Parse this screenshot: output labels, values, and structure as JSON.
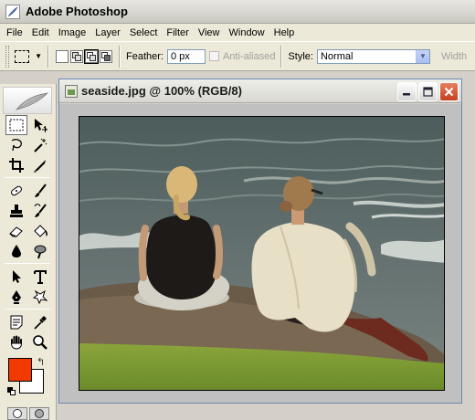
{
  "app": {
    "title": "Adobe Photoshop",
    "icon": "photoshop-feather-icon"
  },
  "menu": [
    "File",
    "Edit",
    "Image",
    "Layer",
    "Select",
    "Filter",
    "View",
    "Window",
    "Help"
  ],
  "options": {
    "feather_label": "Feather:",
    "feather_value": "0 px",
    "antialias_label": "Anti-aliased",
    "style_label": "Style:",
    "style_value": "Normal",
    "width_label": "Width"
  },
  "document": {
    "title": "seaside.jpg @ 100% (RGB/8)"
  },
  "colors": {
    "foreground": "#f23a00",
    "background": "#ffffff",
    "doc_border": "#6b89b8",
    "close_button": "#d0502b"
  },
  "tools": [
    "rectangular-marquee-tool",
    "move-tool",
    "lasso-tool",
    "magic-wand-tool",
    "crop-tool",
    "slice-tool",
    "healing-brush-tool",
    "brush-tool",
    "clone-stamp-tool",
    "history-brush-tool",
    "eraser-tool",
    "paint-bucket-tool",
    "blur-tool",
    "dodge-tool",
    "path-selection-tool",
    "type-tool",
    "pen-tool",
    "shape-tool",
    "notes-tool",
    "eyedropper-tool",
    "hand-tool",
    "zoom-tool"
  ]
}
